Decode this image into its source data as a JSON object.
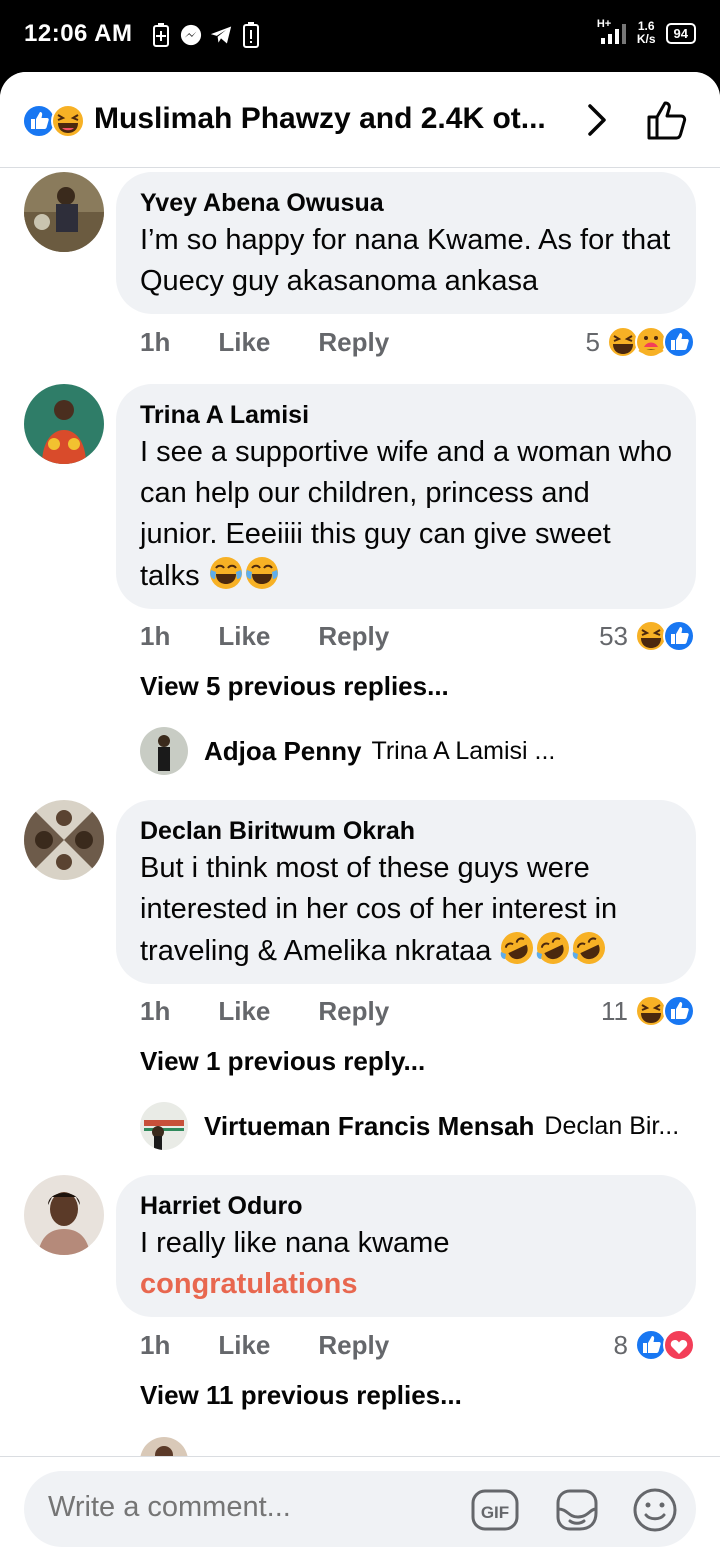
{
  "status_bar": {
    "time": "12:06 AM",
    "net_speed_value": "1.6",
    "net_speed_unit": "K/s",
    "network_type": "H+",
    "battery": "94"
  },
  "header": {
    "title": "Muslimah Phawzy and 2.4K ot...",
    "reaction_icons": [
      "like-icon",
      "haha-icon"
    ]
  },
  "comments": [
    {
      "name": "Yvey Abena Owusua",
      "text": "I’m so happy for nana Kwame. As for that Quecy guy akasanoma ankasa",
      "time": "1h",
      "like_label": "Like",
      "reply_label": "Reply",
      "reaction_count": "5",
      "reactions": [
        "haha-icon",
        "care-icon",
        "like-icon"
      ]
    },
    {
      "name": "Trina A Lamisi",
      "text": "I see a supportive wife and a woman who can help our children, princess and junior. Eeeiiii this guy can give sweet talks",
      "emojis": [
        "joy-emoji",
        "joy-emoji"
      ],
      "time": "1h",
      "like_label": "Like",
      "reply_label": "Reply",
      "reaction_count": "53",
      "reactions": [
        "haha-icon",
        "like-icon"
      ],
      "view_previous": "View 5 previous replies...",
      "reply_preview": {
        "name": "Adjoa Penny",
        "snippet": "Trina A Lamisi ..."
      }
    },
    {
      "name": "Declan Biritwum Okrah",
      "text": "But i think most of these guys were interested in her cos of her interest in traveling & Amelika nkrataa",
      "emojis": [
        "rofl-emoji",
        "rofl-emoji",
        "rofl-emoji"
      ],
      "time": "1h",
      "like_label": "Like",
      "reply_label": "Reply",
      "reaction_count": "11",
      "reactions": [
        "haha-icon",
        "like-icon"
      ],
      "view_previous": "View 1 previous reply...",
      "reply_preview": {
        "name": "Virtueman Francis Mensah",
        "snippet": "Declan Bir..."
      }
    },
    {
      "name": "Harriet Oduro",
      "text": "I really like nana kwame",
      "link_text": "congratulations",
      "time": "1h",
      "like_label": "Like",
      "reply_label": "Reply",
      "reaction_count": "8",
      "reactions": [
        "like-icon",
        "love-icon"
      ],
      "view_previous": "View 11 previous replies..."
    }
  ],
  "composer": {
    "placeholder": "Write a comment...",
    "icons": [
      "gif-icon",
      "sticker-icon",
      "emoji-icon"
    ]
  },
  "colors": {
    "facebook_blue": "#1877f2",
    "bubble_bg": "#f0f2f5",
    "secondary_text": "#65676b",
    "link_orange": "#e8674f",
    "love_red": "#f33e58",
    "haha_yellow": "#f7b125"
  }
}
